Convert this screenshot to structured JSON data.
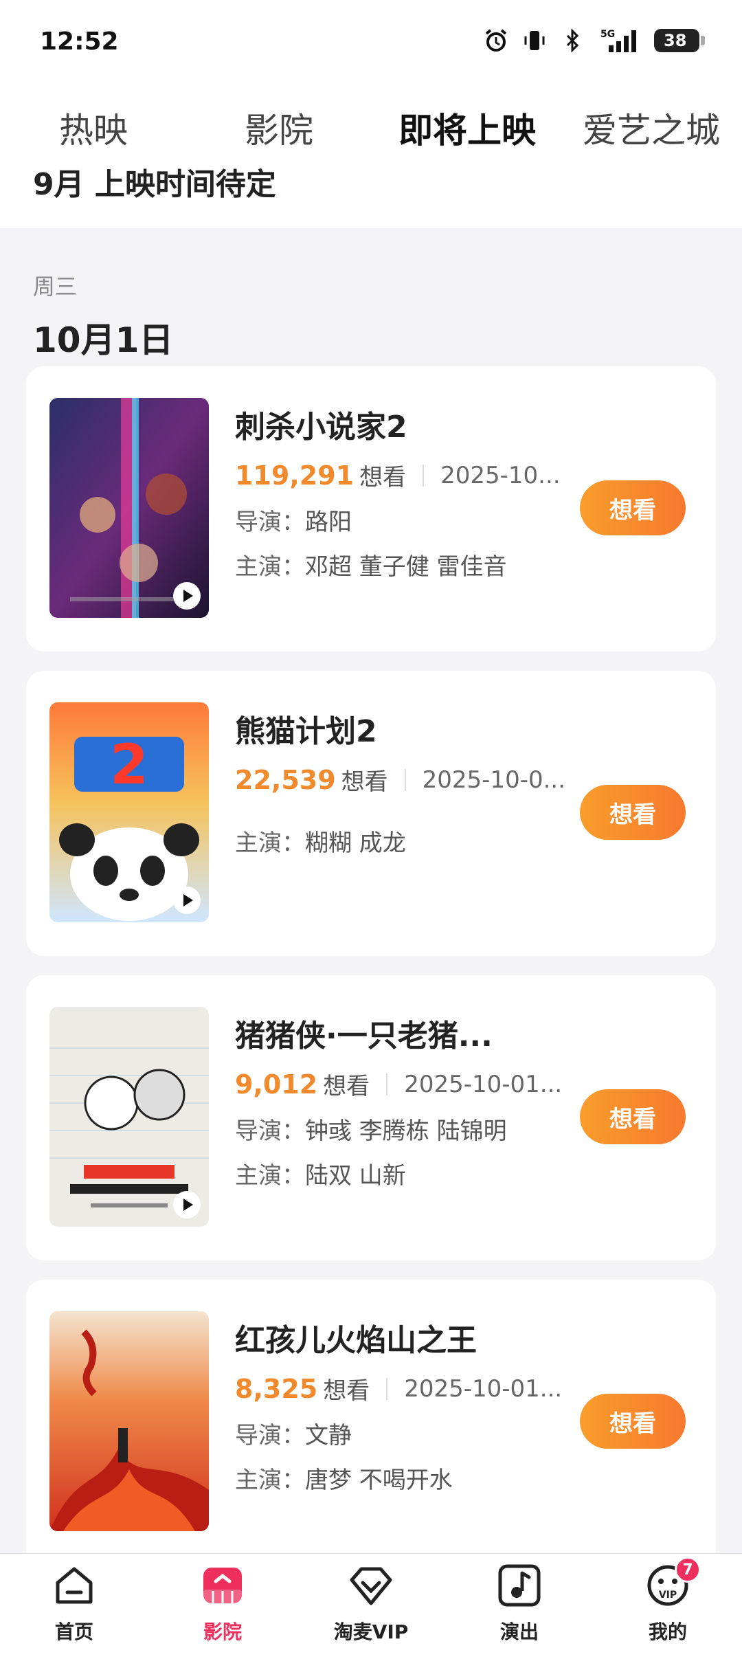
{
  "status_bar": {
    "time": "12:52",
    "battery": "38"
  },
  "tabs": [
    {
      "label": "热映"
    },
    {
      "label": "影院"
    },
    {
      "label": "即将上映"
    },
    {
      "label": "爱艺之城"
    }
  ],
  "sub_header": "9月 上映时间待定",
  "section": {
    "weekday": "周三",
    "date": "10月1日"
  },
  "movies": [
    {
      "title": "刺杀小说家2",
      "count": "119,291",
      "want_label": "想看",
      "release": "2025-10...",
      "director_label": "导演：",
      "director": "路阳",
      "cast_label": "主演：",
      "cast": "邓超 董子健 雷佳音",
      "button": "想看"
    },
    {
      "title": "熊猫计划2",
      "count": "22,539",
      "want_label": "想看",
      "release": "2025-10-0...",
      "cast_label": "主演：",
      "cast": "糊糊 成龙",
      "button": "想看"
    },
    {
      "title": "猪猪侠·一只老猪...",
      "count": "9,012",
      "want_label": "想看",
      "release": "2025-10-01...",
      "director_label": "导演：",
      "director": "钟彧 李腾栋 陆锦明",
      "cast_label": "主演：",
      "cast": "陆双 山新",
      "button": "想看"
    },
    {
      "title": "红孩儿火焰山之王",
      "count": "8,325",
      "want_label": "想看",
      "release": "2025-10-01...",
      "director_label": "导演：",
      "director": "文静",
      "cast_label": "主演：",
      "cast": "唐梦 不喝开水",
      "button": "想看"
    }
  ],
  "bottom_nav": [
    {
      "label": "首页",
      "icon": "home-icon"
    },
    {
      "label": "影院",
      "icon": "cinema-icon"
    },
    {
      "label": "淘麦VIP",
      "icon": "vip-diamond-icon"
    },
    {
      "label": "演出",
      "icon": "music-note-icon"
    },
    {
      "label": "我的",
      "icon": "profile-icon",
      "badge": "7",
      "icon_text": "VIP"
    }
  ],
  "colors": {
    "accent": "#ee2e5c",
    "count": "#f08a2c",
    "button": "#f7892d"
  }
}
